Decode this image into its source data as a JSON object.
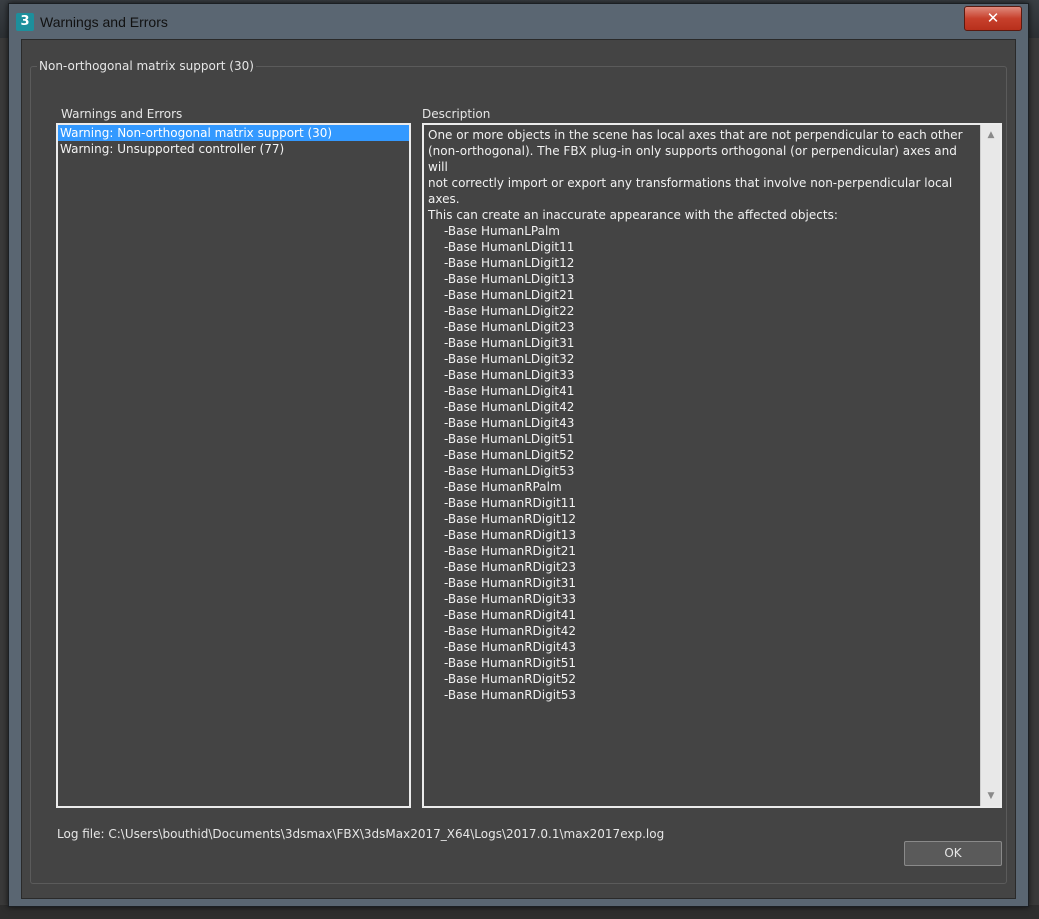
{
  "window": {
    "title": "Warnings and Errors",
    "icon_glyph": "3",
    "close_glyph": "✕"
  },
  "group": {
    "title": "Non-orthogonal matrix support (30)"
  },
  "list": {
    "label": "Warnings and Errors",
    "items": [
      {
        "label": "Warning: Non-orthogonal matrix support (30)",
        "selected": true
      },
      {
        "label": "Warning: Unsupported controller (77)",
        "selected": false
      }
    ]
  },
  "description": {
    "label": "Description",
    "lines": [
      "One or more objects in the scene has local axes that are not perpendicular to each other",
      "(non-orthogonal). The FBX plug-in only supports orthogonal (or perpendicular) axes and will",
      "not correctly import or export any transformations that involve non-perpendicular local axes.",
      "This can create an inaccurate appearance with the affected objects:"
    ],
    "objects": [
      "-Base HumanLPalm",
      "-Base HumanLDigit11",
      "-Base HumanLDigit12",
      "-Base HumanLDigit13",
      "-Base HumanLDigit21",
      "-Base HumanLDigit22",
      "-Base HumanLDigit23",
      "-Base HumanLDigit31",
      "-Base HumanLDigit32",
      "-Base HumanLDigit33",
      "-Base HumanLDigit41",
      "-Base HumanLDigit42",
      "-Base HumanLDigit43",
      "-Base HumanLDigit51",
      "-Base HumanLDigit52",
      "-Base HumanLDigit53",
      "-Base HumanRPalm",
      "-Base HumanRDigit11",
      "-Base HumanRDigit12",
      "-Base HumanRDigit13",
      "-Base HumanRDigit21",
      "-Base HumanRDigit23",
      "-Base HumanRDigit31",
      "-Base HumanRDigit33",
      "-Base HumanRDigit41",
      "-Base HumanRDigit42",
      "-Base HumanRDigit43",
      "-Base HumanRDigit51",
      "-Base HumanRDigit52",
      "-Base HumanRDigit53"
    ],
    "scroll_up_glyph": "▲",
    "scroll_down_glyph": "▼"
  },
  "footer": {
    "log_file": "Log file: C:\\Users\\bouthid\\Documents\\3dsmax\\FBX\\3dsMax2017_X64\\Logs\\2017.0.1\\max2017exp.log",
    "ok_label": "OK"
  },
  "colors": {
    "selection": "#3399ff",
    "panel_bg": "#444444",
    "close_button": "#c7402c"
  }
}
